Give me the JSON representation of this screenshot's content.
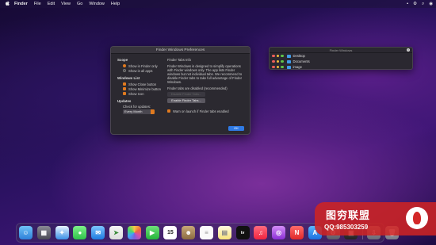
{
  "menubar": {
    "apple": "",
    "items": [
      "Finder",
      "File",
      "Edit",
      "View",
      "Go",
      "Window",
      "Help"
    ]
  },
  "prefs": {
    "title": "Finder Windows Preferences",
    "scope": {
      "heading": "Scope",
      "options": [
        "Show in Finder only",
        "Show in all apps"
      ],
      "selected": 0
    },
    "windows_list": {
      "heading": "Windows List",
      "checkboxes": [
        "Show Close button",
        "Show Minimize button",
        "Show Icon"
      ]
    },
    "updates": {
      "heading": "Updates",
      "label": "Check for updates:",
      "value": "Every Month"
    },
    "tabs_info": {
      "heading": "Finder Tabs Info",
      "body": "Finder Windows is designed to simplify operations with Finder windows only. The app lists Finder windows but not individual tabs. We recommend to disable Finder tabs to take full advantage of Finder Windows.",
      "status": "Finder tabs are disabled (recommended)",
      "disable_btn": "Disable Finder Tabs...",
      "enable_btn": "Enable Finder Tabs...",
      "warn_label": "Warn on launch if Finder tabs enabled"
    },
    "ok": "OK"
  },
  "finder_windows": {
    "title": "Finder Windows",
    "rows": [
      "Desktop",
      "Documents",
      "image"
    ]
  },
  "dock": {
    "calendar_day": "15",
    "tv": "tv"
  },
  "watermark": {
    "line1": "图穷联盟",
    "line2": "QQ:985303259"
  }
}
